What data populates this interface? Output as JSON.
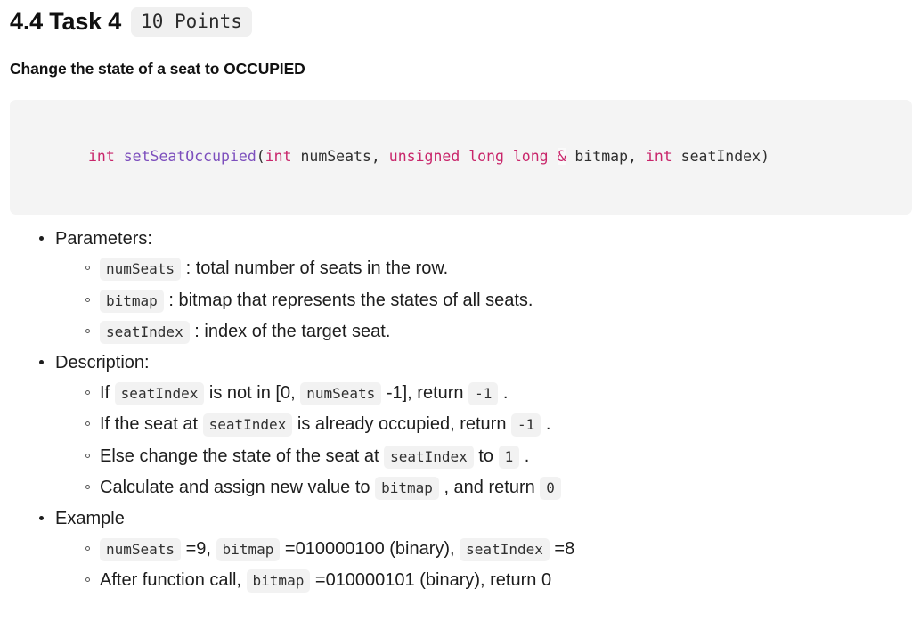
{
  "heading": {
    "title": "4.4 Task 4",
    "points_badge": "10 Points",
    "subtitle": "Change the state of a seat to OCCUPIED"
  },
  "code_signature": {
    "full_text": "int setSeatOccupied(int numSeats, unsigned long long & bitmap, int seatIndex)",
    "tokens": {
      "kw_int_1": "int",
      "space_1": " ",
      "fn_name": "setSeatOccupied",
      "paren_open": "(",
      "kw_int_2": "int",
      "arg_numseats": " numSeats, ",
      "kw_unsigned_long_long": "unsigned long long",
      "space_2": " ",
      "amp": "&",
      "arg_bitmap": " bitmap, ",
      "kw_int_3": "int",
      "arg_seatindex": " seatIndex)"
    },
    "colors": {
      "keyword": "#c9266b",
      "function": "#7d4fbd",
      "plain": "#2f2f2f",
      "background": "#f4f4f4"
    }
  },
  "sections": {
    "parameters": {
      "label": "Parameters:",
      "items": [
        {
          "code": "numSeats",
          "text": " : total number of seats in the row."
        },
        {
          "code": "bitmap",
          "text": " : bitmap that represents the states of all seats."
        },
        {
          "code": "seatIndex",
          "text": " : index of the target seat."
        }
      ]
    },
    "description": {
      "label": "Description:",
      "items": [
        {
          "p1": "If ",
          "c1": "seatIndex",
          "p2": " is not in [0, ",
          "c2": "numSeats",
          "p3": " -1], return ",
          "c3": "-1",
          "p4": " ."
        },
        {
          "p1": "If the seat at ",
          "c1": "seatIndex",
          "p2": " is already occupied, return ",
          "c2": "-1",
          "p3": " .",
          "c3": "",
          "p4": ""
        },
        {
          "p1": "Else change the state of the seat at ",
          "c1": "seatIndex",
          "p2": " to ",
          "c2": "1",
          "p3": " .",
          "c3": "",
          "p4": ""
        },
        {
          "p1": "Calculate and assign new value to ",
          "c1": "bitmap",
          "p2": " , and return ",
          "c2": "0",
          "p3": "",
          "c3": "",
          "p4": ""
        }
      ]
    },
    "example": {
      "label": "Example",
      "items": [
        {
          "p1": "",
          "c1": "numSeats",
          "p2": " =9, ",
          "c2": "bitmap",
          "p3": " =010000100 (binary), ",
          "c3": "seatIndex",
          "p4": " =8"
        },
        {
          "p1": "After function call, ",
          "c1": "bitmap",
          "p2": " =010000101 (binary), return 0",
          "c2": "",
          "p3": "",
          "c3": "",
          "p4": ""
        }
      ]
    }
  }
}
